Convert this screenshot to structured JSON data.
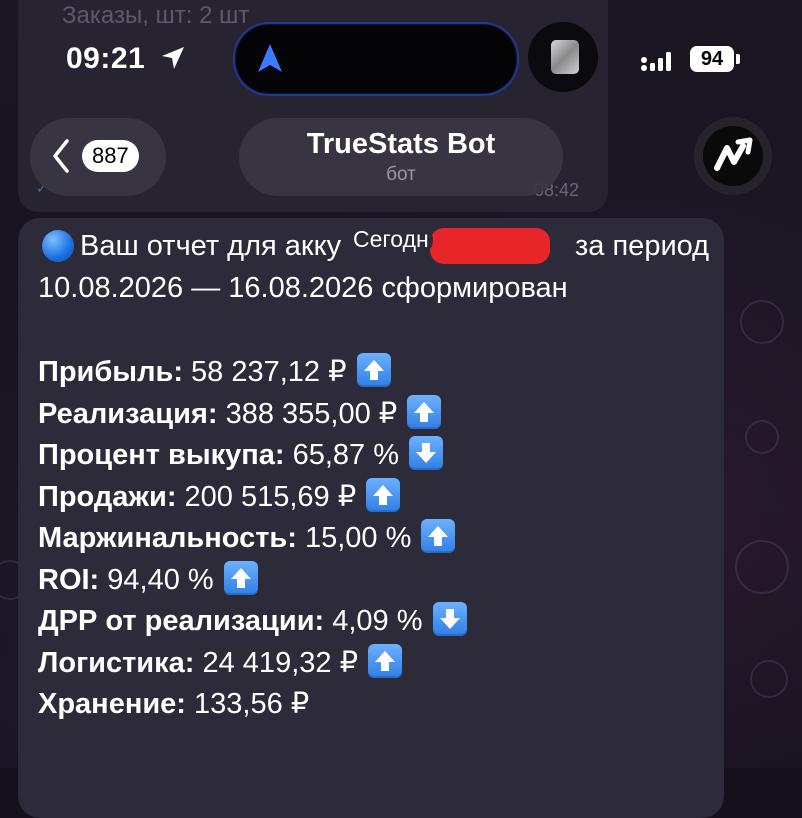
{
  "status_bar": {
    "time": "09:21",
    "battery": "94"
  },
  "previous_message": {
    "text": "Заказы, шт: 2 шт",
    "time": "08:42"
  },
  "header": {
    "back_count": "887",
    "title": "TrueStats Bot",
    "subtitle": "бот"
  },
  "date_chip": "Сегодн",
  "message": {
    "line1_start": "Ваш отчет для акку",
    "line1_end": "за период",
    "line2": "10.08.2026 — 16.08.2026 сформирован",
    "stats": [
      {
        "label": "Прибыль:",
        "value": "58 237,12 ₽",
        "trend": "up"
      },
      {
        "label": "Реализация:",
        "value": "388 355,00 ₽",
        "trend": "up"
      },
      {
        "label": "Процент выкупа:",
        "value": "65,87 %",
        "trend": "down"
      },
      {
        "label": "Продажи:",
        "value": "200 515,69 ₽",
        "trend": "up"
      },
      {
        "label": "Маржинальность:",
        "value": "15,00 %",
        "trend": "up"
      },
      {
        "label": "ROI:",
        "value": "94,40 %",
        "trend": "up"
      },
      {
        "label": "ДРР от реализации:",
        "value": "4,09 %",
        "trend": "down"
      },
      {
        "label": "Логистика:",
        "value": "24 419,32 ₽",
        "trend": "up"
      },
      {
        "label": "Хранение:",
        "value": "133,56 ₽",
        "trend": "none"
      }
    ]
  },
  "colors": {
    "accent": "#2f7fe6",
    "bubble": "#2d2a39",
    "redaction": "#e8262a"
  }
}
